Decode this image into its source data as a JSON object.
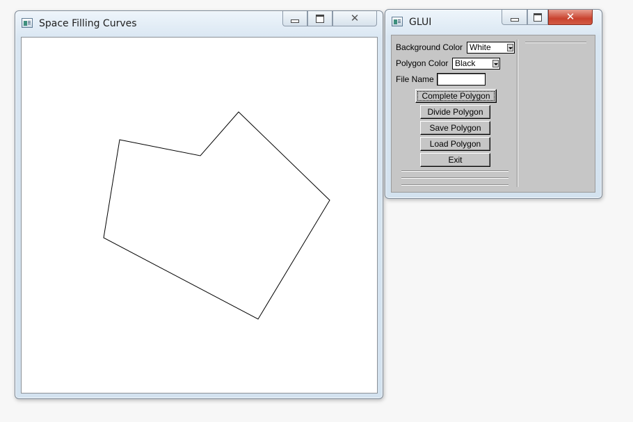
{
  "windows": {
    "space": {
      "title": "Space Filling Curves",
      "icon": "app-window-icon",
      "canvas_background": "#ffffff",
      "polygon_color": "#000000"
    },
    "glui": {
      "title": "GLUI",
      "icon": "app-window-icon",
      "background_color_label": "Background Color",
      "background_color_value": "White",
      "polygon_color_label": "Polygon Color",
      "polygon_color_value": "Black",
      "file_name_label": "File Name",
      "file_name_value": "",
      "buttons": {
        "complete": "Complete Polygon",
        "divide": "Divide Polygon",
        "save": "Save Polygon",
        "load": "Load Polygon",
        "exit": "Exit"
      }
    }
  },
  "caption_buttons": [
    "minimize-icon",
    "maximize-icon",
    "close-icon"
  ]
}
